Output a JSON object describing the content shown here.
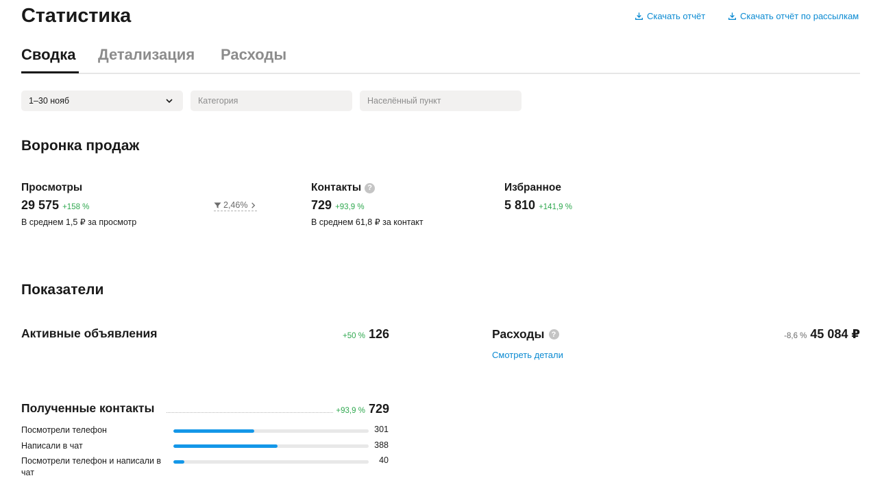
{
  "header": {
    "title": "Статистика",
    "download_report": "Скачать отчёт",
    "download_mailing_report": "Скачать отчёт по рассылкам"
  },
  "tabs": [
    {
      "label": "Сводка",
      "active": true
    },
    {
      "label": "Детализация",
      "active": false
    },
    {
      "label": "Расходы",
      "active": false
    }
  ],
  "filters": {
    "date_value": "1–30 нояб",
    "category_placeholder": "Категория",
    "city_placeholder": "Населённый пункт"
  },
  "funnel": {
    "title": "Воронка продаж",
    "views": {
      "label": "Просмотры",
      "value": "29 575",
      "delta": "+158 %",
      "sub": "В среднем 1,5 ₽ за просмотр"
    },
    "conversion": "2,46%",
    "contacts": {
      "label": "Контакты",
      "value": "729",
      "delta": "+93,9 %",
      "sub": "В среднем 61,8 ₽ за контакт"
    },
    "favorites": {
      "label": "Избранное",
      "value": "5 810",
      "delta": "+141,9 %"
    }
  },
  "indicators": {
    "title": "Показатели",
    "active_ads": {
      "label": "Активные объявления",
      "delta": "+50 %",
      "value": "126"
    },
    "expenses": {
      "label": "Расходы",
      "delta": "-8,6 %",
      "value": "45 084 ₽",
      "details_link": "Смотреть детали"
    },
    "received_contacts": {
      "label": "Полученные контакты",
      "delta": "+93,9 %",
      "value": "729",
      "rows": [
        {
          "label": "Посмотрели телефон",
          "value": "301",
          "fraction": 0.413
        },
        {
          "label": "Написали в чат",
          "value": "388",
          "fraction": 0.532
        },
        {
          "label": "Посмотрели телефон и написали в чат",
          "value": "40",
          "fraction": 0.055
        }
      ]
    }
  },
  "colors": {
    "accent": "#0a8ad2",
    "positive": "#2fa84f",
    "bar_fill": "#1497e8",
    "filter_bg": "#f2f1f0"
  }
}
